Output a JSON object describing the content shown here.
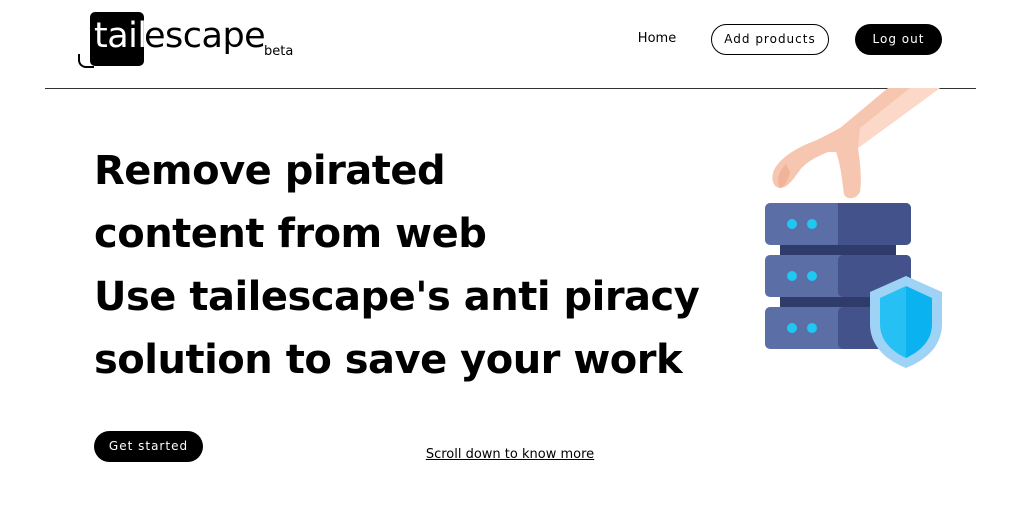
{
  "brand": {
    "logo_part1": "tail",
    "logo_part2": "escape",
    "tag": "beta"
  },
  "nav": {
    "home": "Home",
    "add_products": "Add products",
    "logout": "Log out"
  },
  "hero": {
    "lines": [
      "Remove pirated",
      "content from web",
      "Use tailescape's anti piracy",
      "solution to save your work"
    ],
    "cta": "Get started",
    "scroll_link": "Scroll down to know more"
  },
  "colors": {
    "server_light": "#5b6ea6",
    "server_dark": "#43528a",
    "led": "#1ec8f0",
    "shield_outer": "#9fd3f5",
    "shield_inner": "#0ab3f0",
    "hand": "#f7c6b0"
  },
  "icons": {
    "illustration": "server-shield-hand-illustration"
  }
}
